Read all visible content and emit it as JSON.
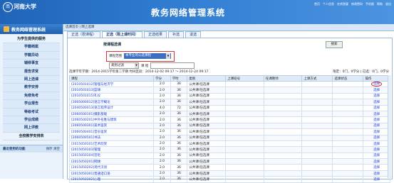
{
  "header": {
    "logo_seal": "南",
    "logo_text": "河南大学",
    "title": "教务网络管理系统",
    "links": [
      "首页",
      "个人信息",
      "在线答疑",
      "修改密码",
      "手机版",
      "帮助",
      "退出"
    ]
  },
  "topbar": {
    "location": "选课首页 | 网上选课"
  },
  "sidebar": {
    "header": "教务网络管理系统",
    "items": [
      {
        "label": "为学生提供的服务",
        "type": "title"
      },
      {
        "label": "学籍档案",
        "type": "sub"
      },
      {
        "label": "学籍异动",
        "type": "sub"
      },
      {
        "label": "辅修事宜",
        "type": "sub"
      },
      {
        "label": "报告求贤",
        "type": "sub"
      },
      {
        "label": "网上选课",
        "type": "sub"
      },
      {
        "label": "教学安排",
        "type": "sub"
      },
      {
        "label": "免修免考",
        "type": "sub"
      },
      {
        "label": "学业报告",
        "type": "sub"
      },
      {
        "label": "等级考试",
        "type": "sub"
      },
      {
        "label": "学业成绩",
        "type": "sub"
      },
      {
        "label": "网上评教",
        "type": "sub"
      },
      {
        "label": "全校教学安排表",
        "type": "title"
      }
    ],
    "recent_label": "最近使用的功能",
    "recent_actions": "保存  清空"
  },
  "tabs": [
    {
      "label": "正选（限课程）",
      "active": false
    },
    {
      "label": "正选（限上课时间）",
      "active": true
    },
    {
      "label": "正选结果",
      "active": false
    },
    {
      "label": "补选",
      "active": false
    },
    {
      "label": "退选",
      "active": false
    }
  ],
  "filter": {
    "title": "按课程选课",
    "search": "搜索",
    "course_scope_label": "课程范围",
    "course_scope_value": "本专业的公选课程",
    "category_label": "类别过滤",
    "course_label": "课  程"
  },
  "info_line": {
    "left": "选课学年学期：2014-2015学年第二学期   时间区段：2014-12-02 09:17 ～ 2014-12-24 09:17",
    "right": "限定：0门，0学分 | 已选：0门，0学分"
  },
  "table": {
    "headers": [
      "课程",
      "学分",
      "学时",
      "类别",
      "上课班号",
      "任课教师",
      "上课方式",
      "选课状态",
      "操作"
    ],
    "rows": [
      {
        "course": "[2010501012]管理与经济学",
        "credit": "2.0",
        "hours": "36",
        "type": "公共课/任选课",
        "action": "选择",
        "highlight": true
      },
      {
        "course": "[2010501013]篮球",
        "credit": "2.0",
        "hours": "36",
        "type": "公共课/任选课",
        "action": "选择"
      },
      {
        "course": "[2010501015]礼仪",
        "credit": "2.0",
        "hours": "36",
        "type": "公共课/任选课",
        "action": "选择"
      },
      {
        "course": "[3005000012]语言学概论",
        "credit": "2.0",
        "hours": "36",
        "type": "公共课/任选课",
        "action": "选择"
      },
      {
        "course": "[2040500013]语言程序设计",
        "credit": "4.0",
        "hours": "72",
        "type": "公共课/任选课",
        "action": "选择"
      },
      {
        "course": "[2060500101]摄影基础",
        "credit": "2.0",
        "hours": "36",
        "type": "公共课/任选课",
        "action": "选择"
      },
      {
        "course": "[2060500201]中外名胜与建筑",
        "credit": "2.0",
        "hours": "36",
        "type": "公共课/任选课",
        "action": "选择"
      },
      {
        "course": "[2060500301]美术鉴赏",
        "credit": "2.0",
        "hours": "36",
        "type": "公共课/任选课",
        "action": "选择"
      },
      {
        "course": "[2060500401]音乐鉴赏",
        "credit": "2.0",
        "hours": "36",
        "type": "公共课/任选课",
        "action": "选择"
      },
      {
        "course": "[2060500501]书法",
        "credit": "2.0",
        "hours": "36",
        "type": "公共课/任选课",
        "action": "选择"
      },
      {
        "course": "[2015050101]艺术欣赏",
        "credit": "2.0",
        "hours": "36",
        "type": "公共课/任选课",
        "action": "选择"
      },
      {
        "course": "[2015050103]管理",
        "credit": "2.0",
        "hours": "36",
        "type": "公共课/任选课",
        "action": "选择"
      },
      {
        "course": "[2015050104]羽毛",
        "credit": "2.0",
        "hours": "36",
        "type": "公共课/任选课",
        "action": "选择"
      },
      {
        "course": "[2015050201]网球",
        "credit": "2.0",
        "hours": "36",
        "type": "公共课/任选课",
        "action": "选择"
      },
      {
        "course": "[2015050202]现代汉语",
        "credit": "2.0",
        "hours": "36",
        "type": "公共课/任选课",
        "action": "选择"
      },
      {
        "course": "[2015050301]普通话口语",
        "credit": "2.0",
        "hours": "36",
        "type": "公共课/任选课",
        "action": "选择"
      },
      {
        "course": "[2015050302]心理",
        "credit": "2.0",
        "hours": "36",
        "type": "公共课/任选课",
        "action": "选择"
      }
    ]
  },
  "colors": {
    "header_blue": "#1f64b7",
    "link": "#1a3dd6",
    "highlight_red": "#e02020"
  }
}
